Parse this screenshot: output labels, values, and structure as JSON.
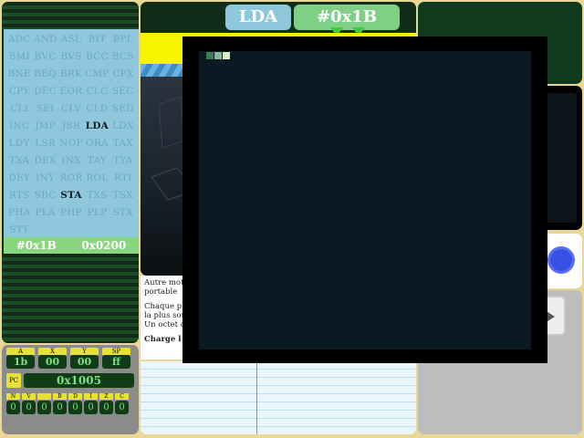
{
  "opcodes": [
    "ADC",
    "AND",
    "ASL",
    "BIT",
    "BPL",
    "BMI",
    "BVC",
    "BVS",
    "BCC",
    "BCS",
    "BNE",
    "BEQ",
    "BRK",
    "CMP",
    "CPX",
    "CPY",
    "DEC",
    "EOR",
    "CLC",
    "SEC",
    "CLI",
    "SEI",
    "CLV",
    "CLD",
    "SED",
    "INC",
    "JMP",
    "JSR",
    "LDA",
    "LDX",
    "LDY",
    "LSR",
    "NOP",
    "ORA",
    "TAX",
    "TXA",
    "DEX",
    "INX",
    "TAY",
    "TYA",
    "DEY",
    "INY",
    "ROR",
    "ROL",
    "RTI",
    "RTS",
    "SBC",
    "STA",
    "TXS",
    "TSX",
    "PHA",
    "PLA",
    "PHP",
    "PLP",
    "STX",
    "STY"
  ],
  "highlighted_opcodes": [
    "LDA",
    "STA"
  ],
  "address_bar": {
    "left": "#0x1B",
    "right": "0x0200"
  },
  "registers": {
    "labels": [
      "A",
      "X",
      "Y",
      "SP"
    ],
    "values": [
      "1b",
      "00",
      "00",
      "ff"
    ],
    "pc_label": "PC",
    "pc_value": "0x1005",
    "flag_labels": [
      "N",
      "V",
      "",
      "B",
      "D",
      "I",
      "Z",
      "C"
    ],
    "flag_values": [
      "0",
      "0",
      "0",
      "0",
      "0",
      "0",
      "0",
      "0"
    ]
  },
  "instruction": {
    "mnemonic": "LDA",
    "operand": "#0x1B"
  },
  "text": {
    "p1a": "Autre mot",
    "p1b": "portable",
    "p2a": "Chaque p",
    "p2b": "la plus sou",
    "p2c": "Un octet d",
    "p3": "Charge l"
  },
  "colors": {
    "panel_dark": "#0f2d17",
    "opcode_bg": "#8fc8dc",
    "address_bar_bg": "#8ad57f",
    "instruction_bg": "#8fc8dc",
    "operand_bg": "#7fcf86",
    "yellow_band": "#f8f400",
    "blue_button": "#3850e6"
  }
}
